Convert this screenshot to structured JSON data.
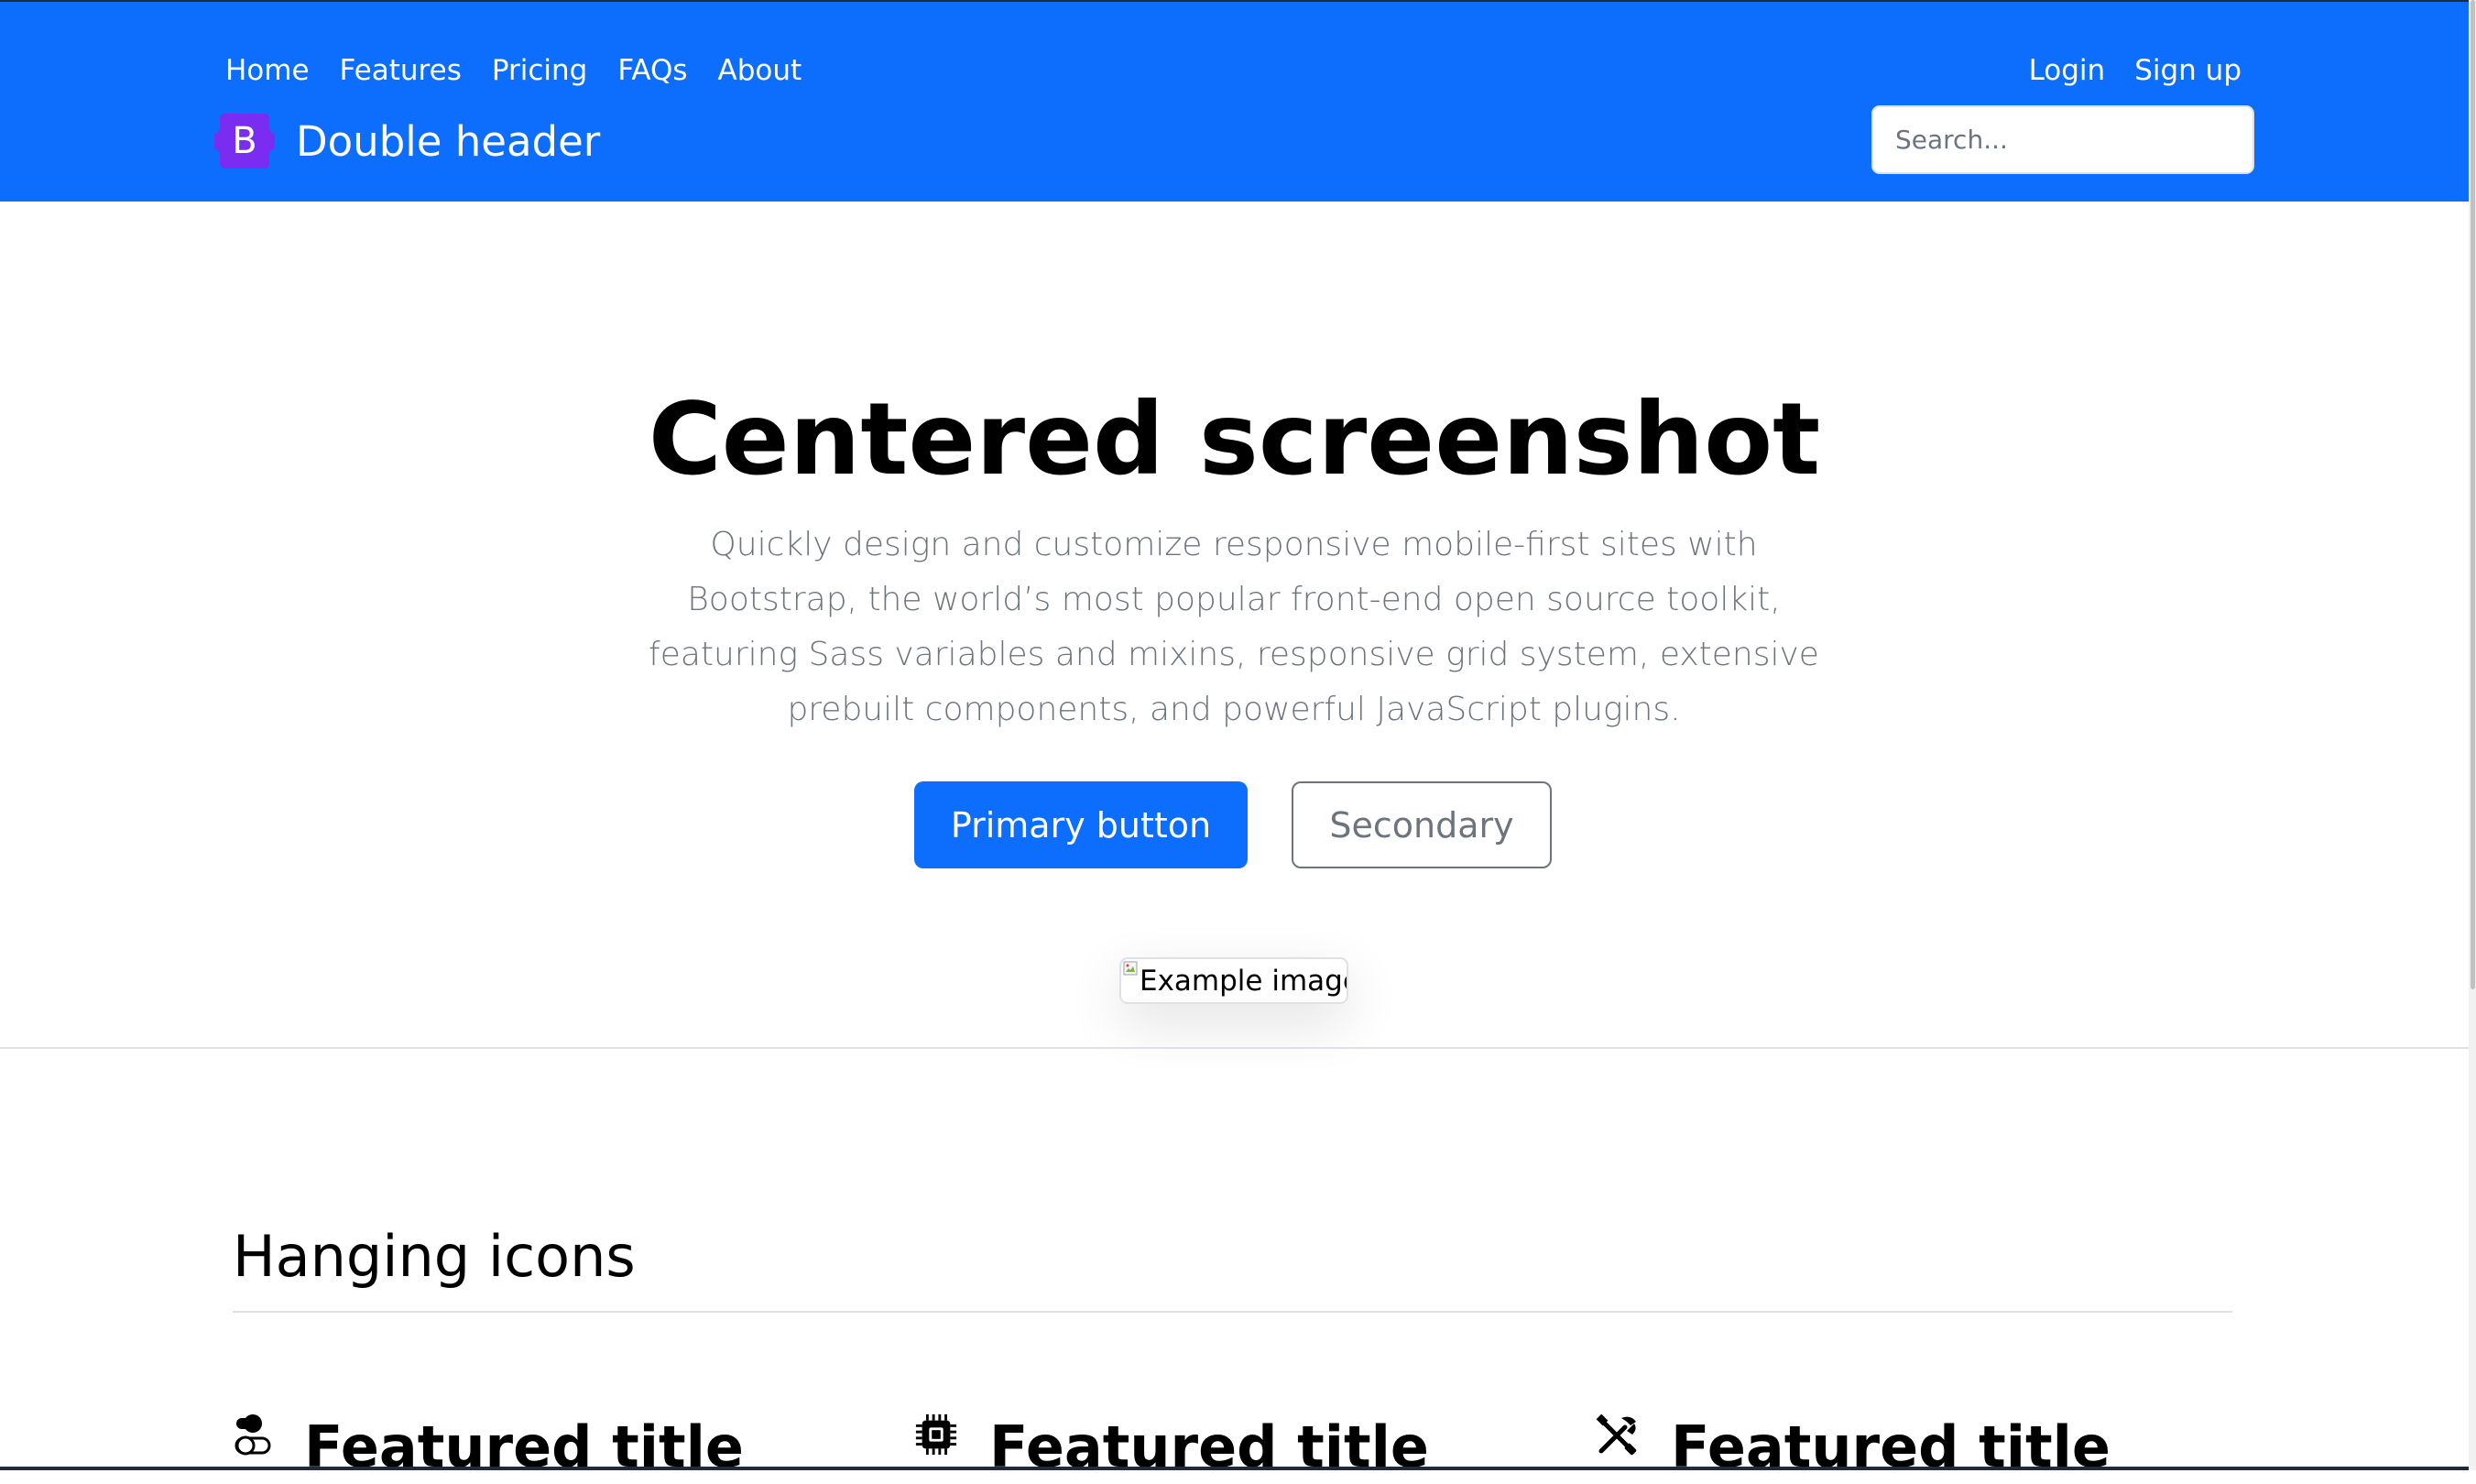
{
  "header": {
    "nav_left": [
      "Home",
      "Features",
      "Pricing",
      "FAQs",
      "About"
    ],
    "nav_right": [
      "Login",
      "Sign up"
    ],
    "brand_letter": "B",
    "brand_title": "Double header",
    "search_placeholder": "Search...",
    "accent_color": "#0d6efd",
    "brand_logo_color": "#7a2cf0"
  },
  "hero": {
    "title": "Centered screenshot",
    "lead": "Quickly design and customize responsive mobile-first sites with Bootstrap, the world’s most popular front-end open source toolkit, featuring Sass variables and mixins, responsive grid system, extensive prebuilt components, and powerful JavaScript plugins.",
    "primary_button": "Primary button",
    "secondary_button": "Secondary",
    "image_alt": "Example image"
  },
  "section": {
    "title": "Hanging icons",
    "features": [
      {
        "icon": "toggles-icon",
        "title": "Featured title"
      },
      {
        "icon": "cpu-icon",
        "title": "Featured title"
      },
      {
        "icon": "tools-icon",
        "title": "Featured title"
      }
    ]
  }
}
